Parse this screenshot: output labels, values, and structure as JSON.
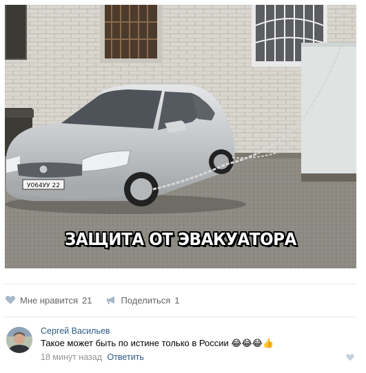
{
  "post": {
    "image_caption": "ЗАЩИТА ОТ ЭВАКУАТОРА",
    "license_plate": "У064УУ 22"
  },
  "actions": {
    "like_label": "Мне нравится",
    "like_count": "21",
    "share_label": "Поделиться",
    "share_count": "1"
  },
  "comment": {
    "author": "Сергей Васильев",
    "text": "Такое может быть по истине только в России",
    "emojis": "😂😂😂👍",
    "time": "18 минут назад",
    "reply_label": "Ответить"
  },
  "colors": {
    "link": "#2a5885",
    "secondary_text": "#939393",
    "action_text": "#656565",
    "icon": "#a8b7c9"
  }
}
